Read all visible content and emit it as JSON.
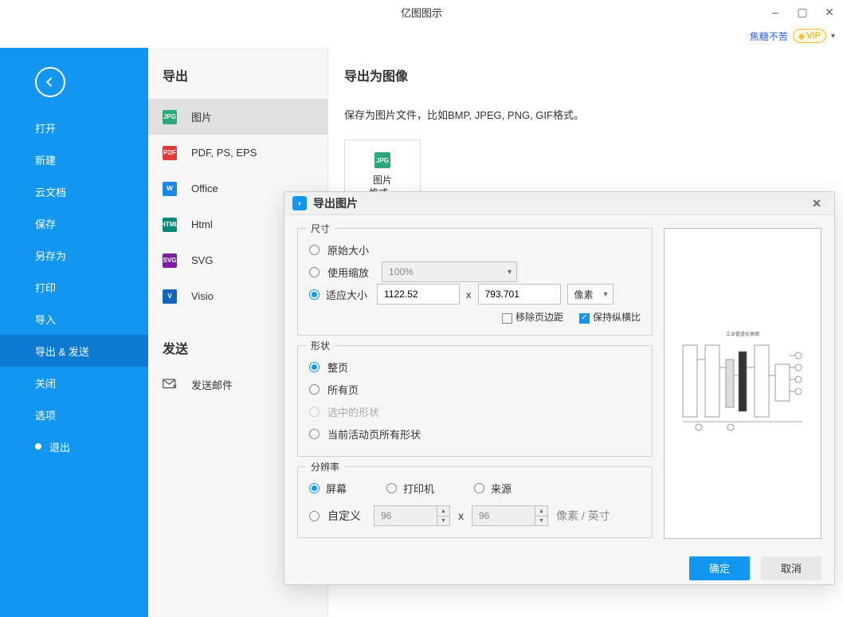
{
  "app_title": "亿图图示",
  "user": {
    "name": "焦糖不苦",
    "vip_label": "VIP"
  },
  "sidebar": {
    "items": [
      {
        "label": "打开"
      },
      {
        "label": "新建"
      },
      {
        "label": "云文档"
      },
      {
        "label": "保存"
      },
      {
        "label": "另存为"
      },
      {
        "label": "打印"
      },
      {
        "label": "导入"
      },
      {
        "label": "导出 & 发送"
      },
      {
        "label": "关闭"
      },
      {
        "label": "选项"
      },
      {
        "label": "退出"
      }
    ]
  },
  "export": {
    "heading": "导出",
    "items": [
      {
        "label": "图片"
      },
      {
        "label": "PDF, PS, EPS"
      },
      {
        "label": "Office"
      },
      {
        "label": "Html"
      },
      {
        "label": "SVG"
      },
      {
        "label": "Visio"
      }
    ],
    "send_heading": "发送",
    "send_items": [
      {
        "label": "发送邮件"
      }
    ]
  },
  "panel": {
    "title": "导出为图像",
    "desc": "保存为图片文件，比如BMP, JPEG, PNG, GIF格式。",
    "card": {
      "line1": "图片",
      "line2": "格式..."
    },
    "icon_text": "JPG"
  },
  "dialog": {
    "title": "导出图片",
    "size": {
      "legend": "尺寸",
      "opt_original": "原始大小",
      "opt_scale": "使用缩放",
      "scale_value": "100%",
      "opt_fit": "适应大小",
      "width": "1122.52",
      "x_label": "x",
      "height": "793.701",
      "unit": "像素",
      "chk_remove_margin": "移除页边距",
      "chk_keep_ratio": "保持纵横比"
    },
    "shape": {
      "legend": "形状",
      "opt_full": "整页",
      "opt_all": "所有页",
      "opt_selected": "选中的形状",
      "opt_current": "当前活动页所有形状"
    },
    "resolution": {
      "legend": "分辨率",
      "opt_screen": "屏幕",
      "opt_printer": "打印机",
      "opt_source": "来源",
      "opt_custom": "自定义",
      "dpi_x": "96",
      "x_label": "x",
      "dpi_y": "96",
      "unit_label": "像素 / 英寸"
    },
    "preview_title": "工业管道仪表图",
    "ok": "确定",
    "cancel": "取消"
  }
}
